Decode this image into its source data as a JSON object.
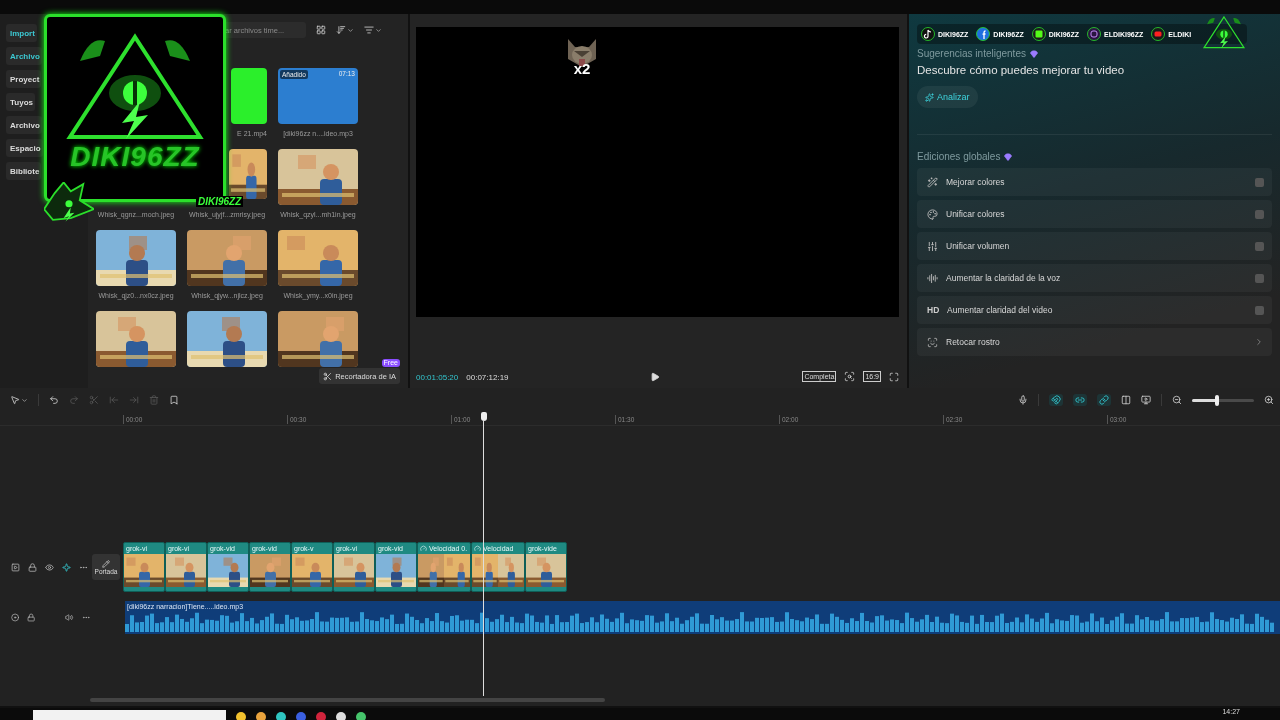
{
  "overlay_logo": {
    "title": "DIKI96ZZ",
    "tag": "DIKI96ZZ"
  },
  "sidebar": {
    "items": [
      {
        "label": "Import",
        "selected": true
      },
      {
        "label": "Archivo",
        "selected": true
      },
      {
        "label": "Proyect",
        "selected": false
      },
      {
        "label": "Tuyos",
        "selected": false
      },
      {
        "label": "Archivo",
        "selected": false
      },
      {
        "label": "Espacio",
        "selected": false
      },
      {
        "label": "Bibliote",
        "selected": false
      }
    ]
  },
  "media": {
    "search": {
      "placeholder": "ar archivos time..."
    },
    "items": [
      {
        "kind": "covered"
      },
      {
        "kind": "green-partial",
        "label": "E 21.mp4"
      },
      {
        "kind": "audio",
        "label": "[diki96zz n....ideo.mp3",
        "badge": "Añadido",
        "duration": "07:13"
      },
      {
        "kind": "covered",
        "label": "Whisk_qgnz...moch.jpeg"
      },
      {
        "kind": "picture-partial",
        "label": "Whisk_ujyjf...zmrisy.jpeg"
      },
      {
        "kind": "picture",
        "label": "Whisk_qzyl...mh1in.jpeg"
      },
      {
        "kind": "picture",
        "label": "Whisk_qjz0...nx0cz.jpeg"
      },
      {
        "kind": "picture",
        "label": "Whisk_qjyw...njlcz.jpeg"
      },
      {
        "kind": "picture",
        "label": "Whisk_ymy...x0in.jpeg"
      },
      {
        "kind": "picture"
      },
      {
        "kind": "picture"
      },
      {
        "kind": "picture"
      }
    ],
    "cutout_button": {
      "label": "Recortadora de IA",
      "badge": "Free"
    }
  },
  "preview": {
    "sticker_text": "x2",
    "current_time": "00:01:05:20",
    "total_time": "00:07:12:19",
    "fit_label": "Completa",
    "ratio_label": "16:9"
  },
  "socials": [
    {
      "kind": "tiktok",
      "name": "DIKI96ZZ"
    },
    {
      "kind": "facebook",
      "name": "DIKI96ZZ"
    },
    {
      "kind": "kick",
      "name": "DIKI96ZZ"
    },
    {
      "kind": "instagram",
      "name": "ELDIKI96ZZ"
    },
    {
      "kind": "youtube",
      "name": "ELDIKI"
    }
  ],
  "suggestions": {
    "title": "Sugerencias inteligentes",
    "text": "Descubre cómo puedes mejorar tu video",
    "button": "Analizar"
  },
  "global_edits": {
    "title": "Ediciones globales",
    "items": [
      {
        "kind": "toggle",
        "label": "Mejorar colores",
        "on": false
      },
      {
        "kind": "toggle",
        "label": "Unificar colores",
        "on": false
      },
      {
        "kind": "toggle",
        "label": "Unificar volumen",
        "on": false
      },
      {
        "kind": "toggle",
        "label": "Aumentar la claridad de la voz",
        "on": false
      },
      {
        "kind": "toggle",
        "icon_text": "HD",
        "label": "Aumentar claridad del video",
        "on": false
      },
      {
        "kind": "arrow",
        "label": "Retocar rostro"
      }
    ]
  },
  "timeline": {
    "tools": [
      {
        "kind": "select",
        "disabled": false
      },
      {
        "kind": "undo",
        "disabled": false
      },
      {
        "kind": "redo",
        "disabled": true
      },
      {
        "kind": "split",
        "disabled": true
      },
      {
        "kind": "split-left",
        "disabled": true
      },
      {
        "kind": "split-right",
        "disabled": true
      },
      {
        "kind": "delete",
        "disabled": true
      },
      {
        "kind": "marker",
        "disabled": false
      }
    ],
    "right_tools": [
      {
        "kind": "mic",
        "on": false
      },
      {
        "kind": "magnet",
        "on": true
      },
      {
        "kind": "linkage",
        "on": true
      },
      {
        "kind": "chain",
        "on": true
      },
      {
        "kind": "columns",
        "on": false
      },
      {
        "kind": "preview",
        "on": false
      }
    ],
    "zoom": {
      "level": 0.4
    },
    "ticks": [
      "00:00",
      "00:30",
      "01:00",
      "01:30",
      "02:00",
      "02:30",
      "03:00"
    ],
    "cover_label": "Portada",
    "clips": [
      {
        "kind": "clip",
        "label": "grok-vi"
      },
      {
        "kind": "clip",
        "label": "grok-vi"
      },
      {
        "kind": "clip",
        "label": "grok-vid"
      },
      {
        "kind": "clip",
        "label": "grok-vid"
      },
      {
        "kind": "clip",
        "label": "grok-v"
      },
      {
        "kind": "clip",
        "label": "grok-vi"
      },
      {
        "kind": "clip",
        "label": "grok-vid"
      },
      {
        "kind": "speed",
        "label": "Velocidad 0."
      },
      {
        "kind": "speed",
        "label": "Velocidad"
      },
      {
        "kind": "clip",
        "label": "grok-vide"
      }
    ],
    "audio_clip": {
      "label": "[diki96zz narracion]Tiene.....ideo.mp3"
    }
  },
  "taskbar": {
    "clock": "14:27"
  }
}
